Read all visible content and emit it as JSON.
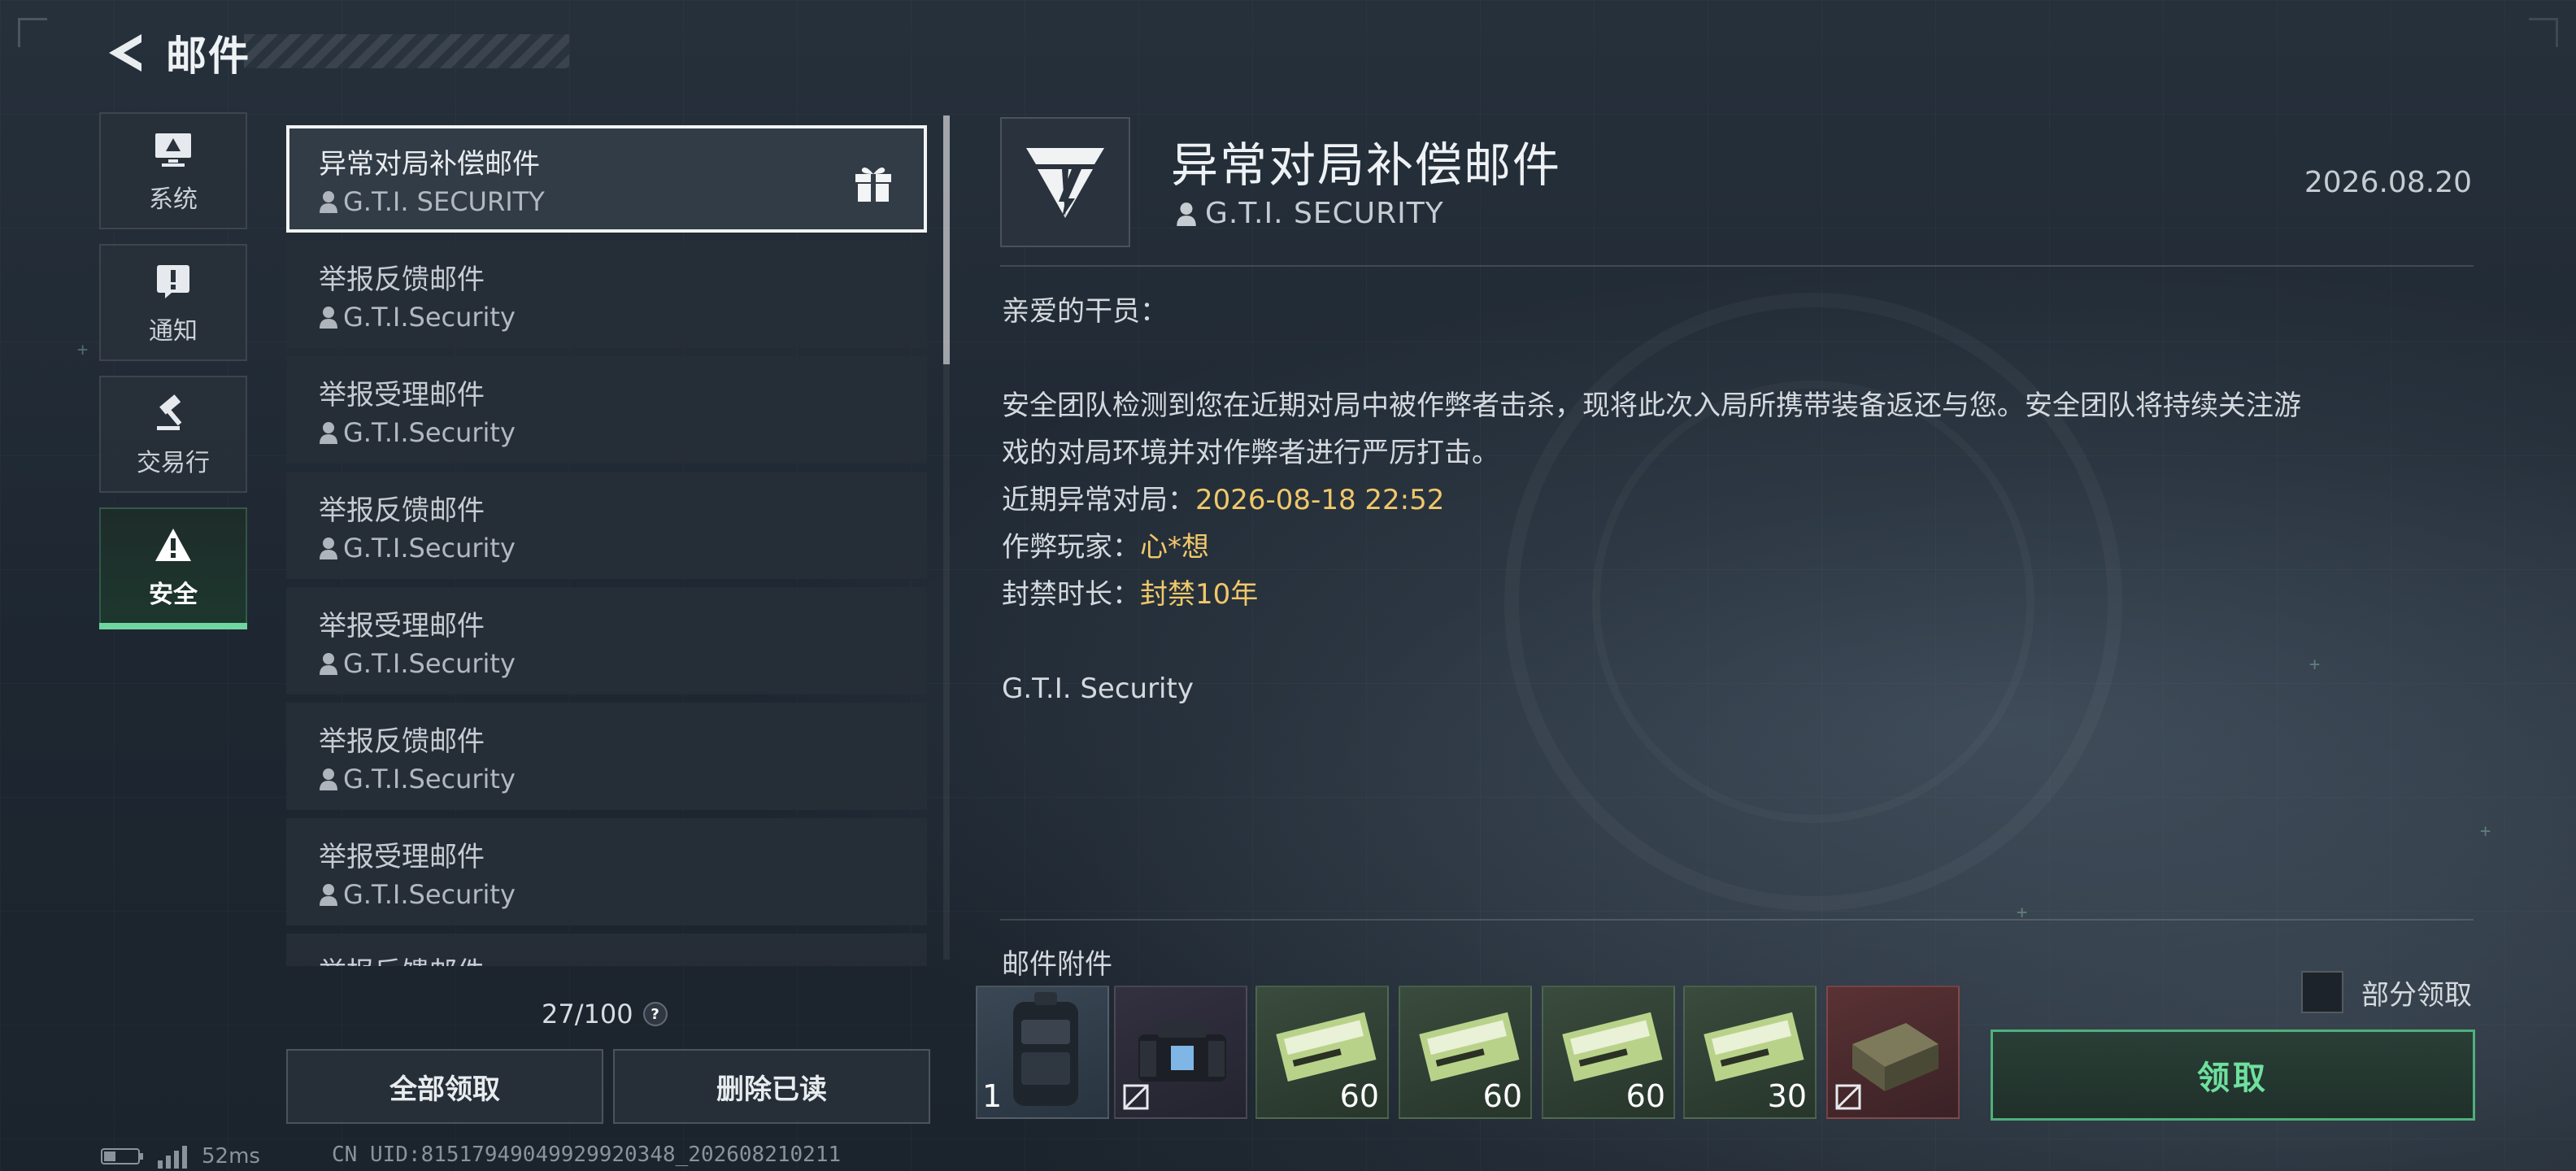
{
  "header": {
    "title": "邮件"
  },
  "categories": [
    {
      "label": "系统",
      "icon": "monitor-icon"
    },
    {
      "label": "通知",
      "icon": "alert-square-icon"
    },
    {
      "label": "交易行",
      "icon": "gavel-icon"
    },
    {
      "label": "安全",
      "icon": "warning-triangle-icon",
      "active": true
    }
  ],
  "mails": [
    {
      "subject": "异常对局补偿邮件",
      "sender": "G.T.I. SECURITY",
      "selected": true,
      "has_gift": true
    },
    {
      "subject": "举报反馈邮件",
      "sender": "G.T.I.Security"
    },
    {
      "subject": "举报受理邮件",
      "sender": "G.T.I.Security"
    },
    {
      "subject": "举报反馈邮件",
      "sender": "G.T.I.Security"
    },
    {
      "subject": "举报受理邮件",
      "sender": "G.T.I.Security"
    },
    {
      "subject": "举报反馈邮件",
      "sender": "G.T.I.Security"
    },
    {
      "subject": "举报受理邮件",
      "sender": "G.T.I.Security"
    },
    {
      "subject": "举报反馈邮件",
      "sender": ""
    }
  ],
  "counter": "27/100",
  "help_glyph": "?",
  "buttons": {
    "claim_all": "全部领取",
    "delete_read": "删除已读",
    "claim": "领取"
  },
  "status": {
    "ping": "52ms",
    "uid": "CN UID:81517949049929920348_202608210211"
  },
  "detail": {
    "title": "异常对局补偿邮件",
    "sender": "G.T.I. SECURITY",
    "date": "2026.08.20",
    "greeting": "亲爱的干员：",
    "paragraph_line1": "安全团队检测到您在近期对局中被作弊者击杀，现将此次入局所携带装备返还与您。安全团队将持续关注游",
    "paragraph_line2": "戏的对局环境并对作弊者进行严厉打击。",
    "match_label": "近期异常对局：",
    "match_value": "2026-08-18 22:52",
    "cheater_label": "作弊玩家：",
    "cheater_value": "心*想",
    "ban_label": "封禁时长：",
    "ban_value": "封禁10年",
    "signature": "G.T.I. Security"
  },
  "attachments": {
    "label": "邮件附件",
    "partial_claim_label": "部分领取",
    "items": [
      {
        "name": "backpack",
        "qty": "1",
        "bound": true
      },
      {
        "name": "chest-rig",
        "qty": "",
        "bound": true
      },
      {
        "name": "ammo-box",
        "qty": "60"
      },
      {
        "name": "ammo-box",
        "qty": "60"
      },
      {
        "name": "ammo-box",
        "qty": "60"
      },
      {
        "name": "ammo-box",
        "qty": "30"
      },
      {
        "name": "armor-crate",
        "qty": "",
        "bound": true
      }
    ]
  },
  "colors": {
    "accent_green": "#6fd6a0",
    "highlight_yellow": "#f0c86a",
    "claim_border": "#4fb07a"
  }
}
